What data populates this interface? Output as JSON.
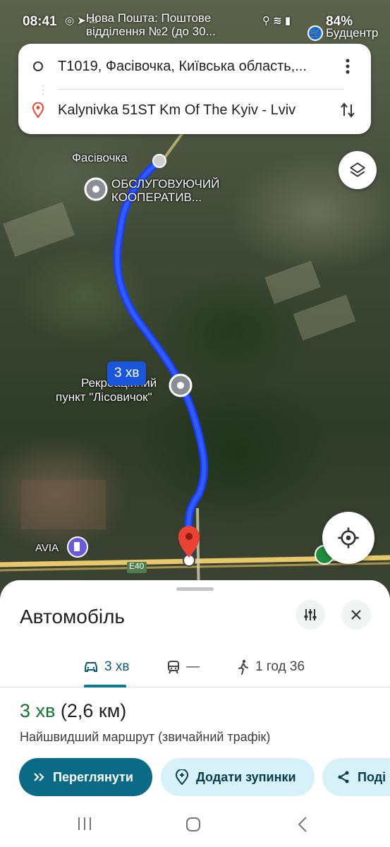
{
  "status": {
    "time": "08:41",
    "notification_title": "Нова Пошта: Поштове відділення №2 (до 30...",
    "battery": "84%"
  },
  "map": {
    "poi_top_right": "Будцентр",
    "label_village": "Фасівочка",
    "label_coop": "ОБСЛУГОВУЮЧИЙ КООПЕРАТИВ...",
    "label_rec_line1": "Рекреаційний",
    "label_rec_line2": "пункт \"Лісовичок\"",
    "label_avia": "AVIA",
    "label_road": "E40",
    "route_chip": "3 хв"
  },
  "search": {
    "origin": "Т1019, Фасівочка, Київська область,...",
    "destination": "Kalynivka 51ST Km Of The Kyiv - Lviv"
  },
  "sheet": {
    "title": "Автомобіль",
    "tabs": [
      {
        "mode": "car",
        "label": "3 хв",
        "active": true
      },
      {
        "mode": "transit",
        "label": "—",
        "active": false
      },
      {
        "mode": "walk",
        "label": "1 год 36",
        "active": false
      }
    ],
    "duration": "3 хв",
    "distance": "(2,6 км)",
    "description": "Найшвидший маршрут (звичайний трафік)",
    "btn_preview": "Переглянути",
    "btn_add_stops": "Додати зупинки",
    "btn_share": "Поді"
  },
  "colors": {
    "route": "#1a3cff",
    "accent": "#0b6a85",
    "duration_green": "#137333",
    "pin_red": "#ea4335"
  }
}
